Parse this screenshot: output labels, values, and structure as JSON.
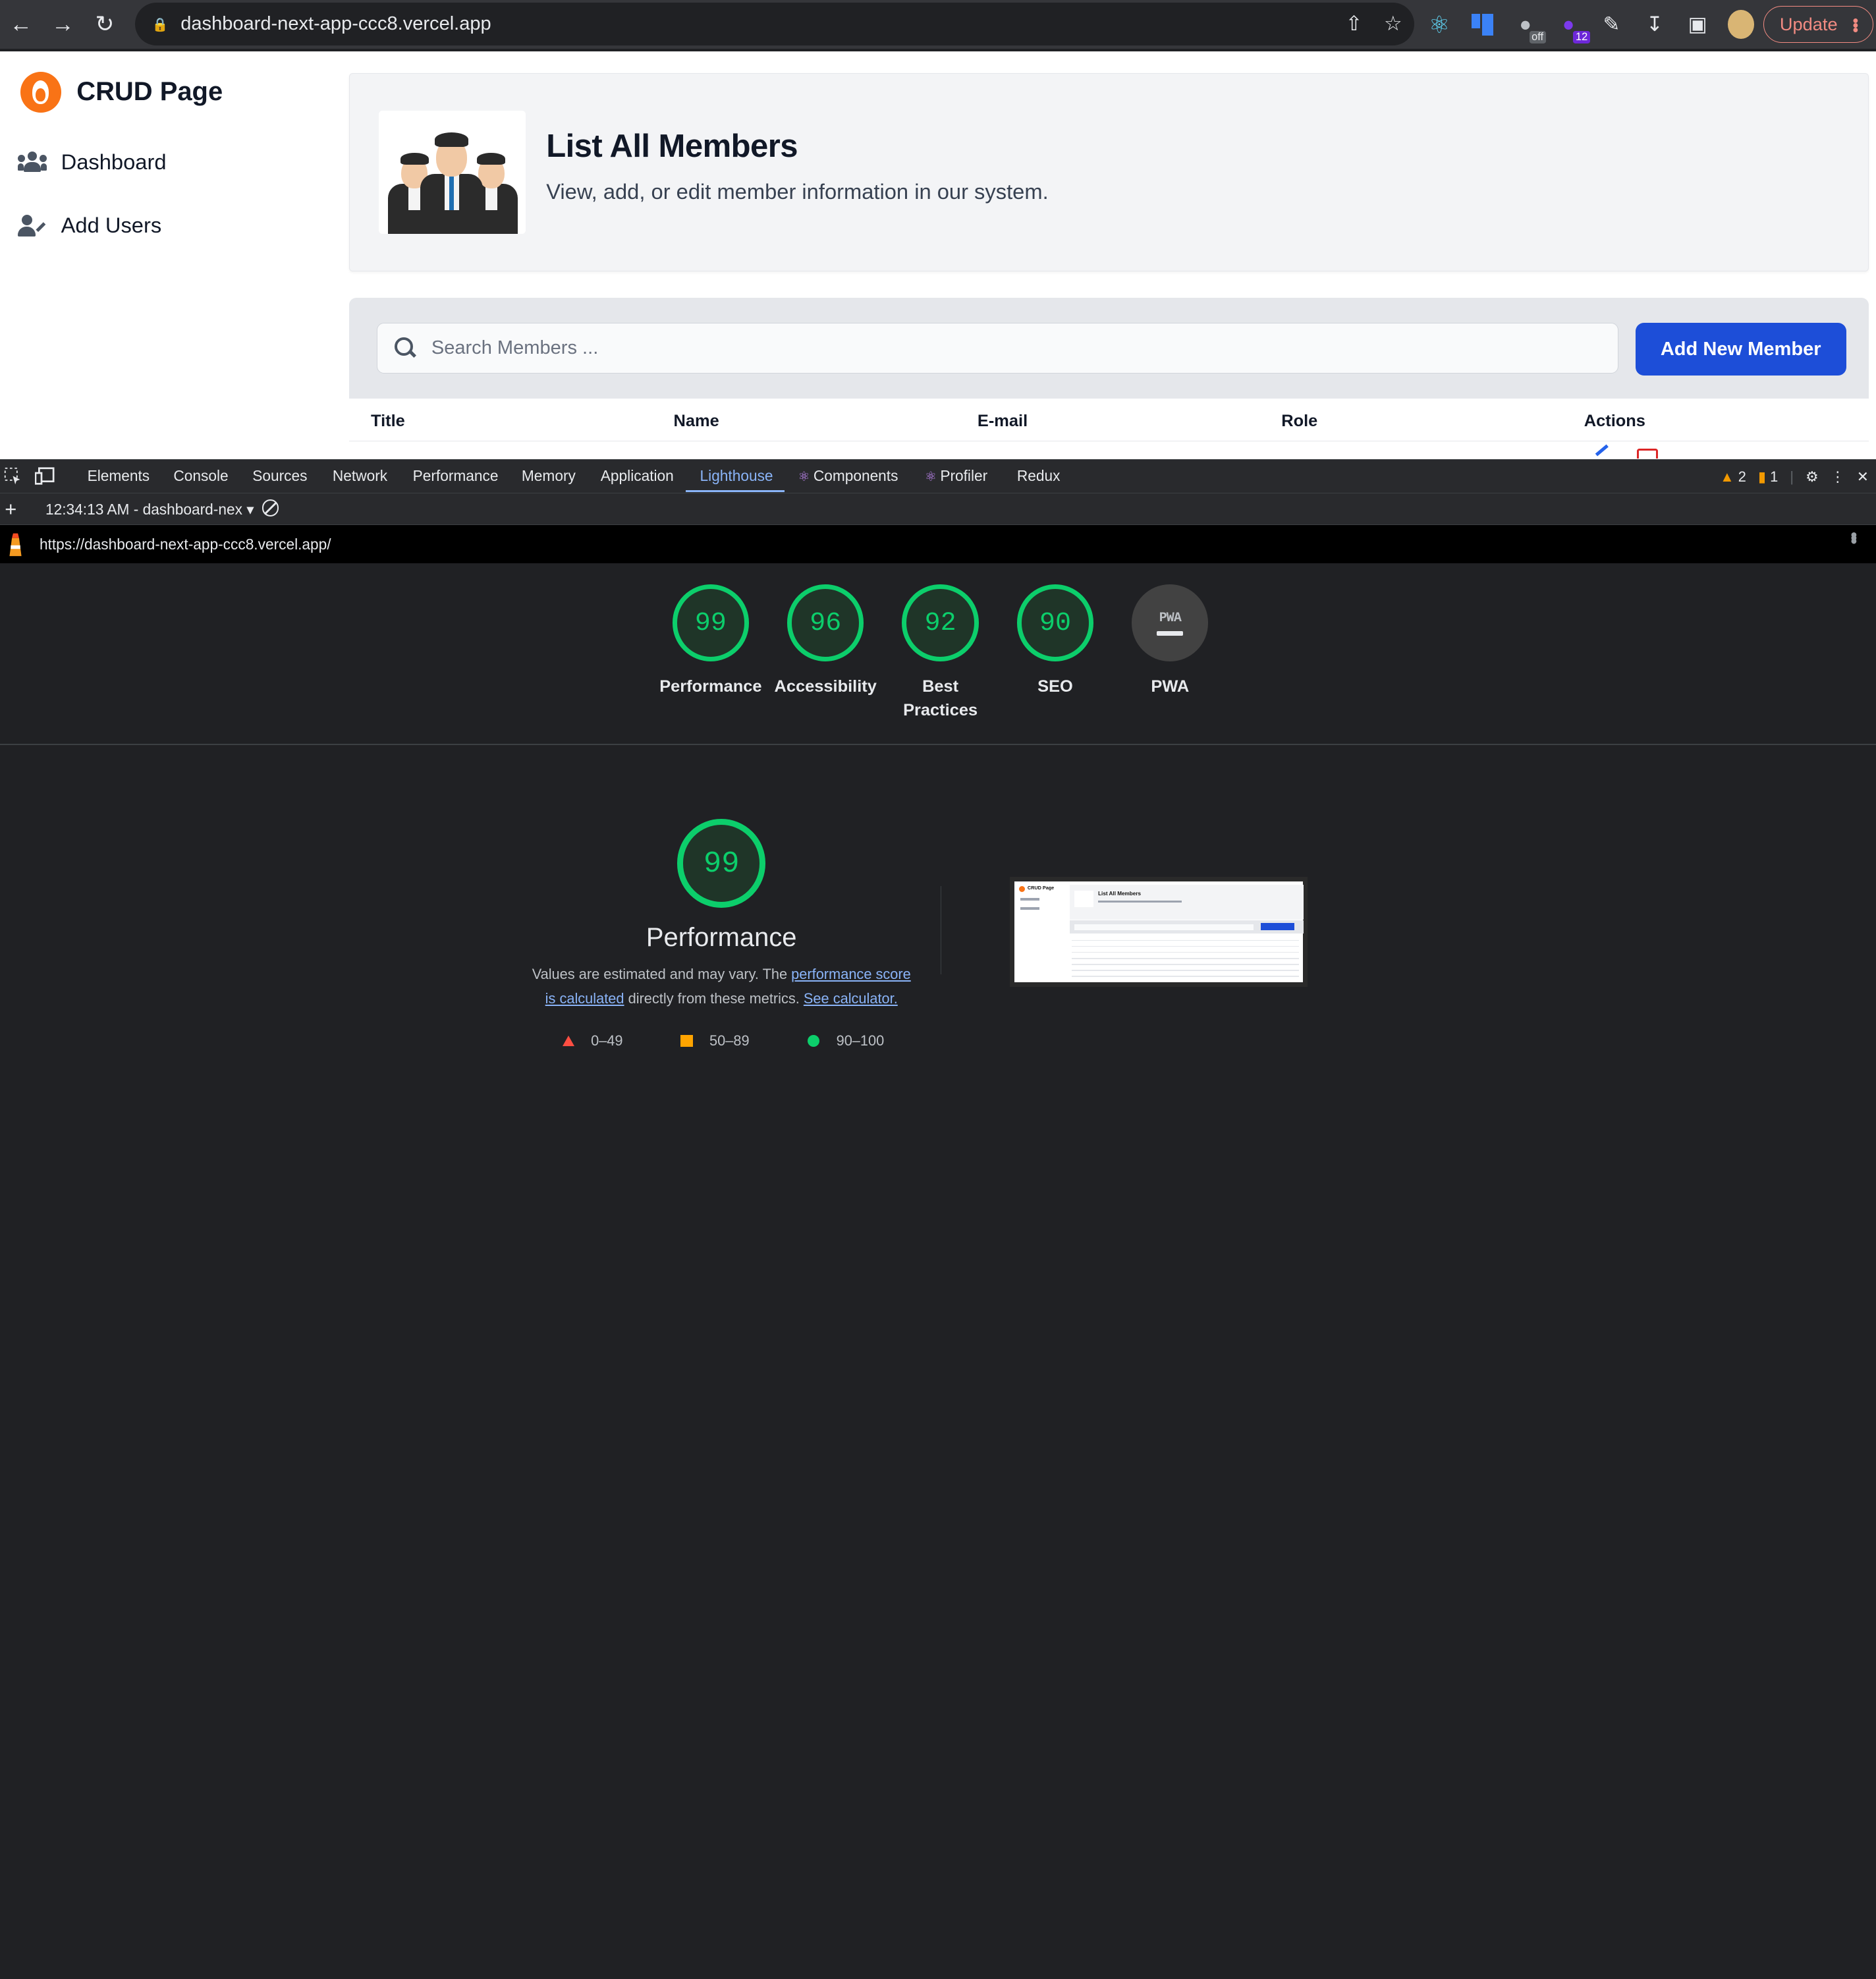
{
  "browser": {
    "url": "dashboard-next-app-ccc8.vercel.app",
    "update_label": "Update",
    "ext_off_badge": "off",
    "ext_count_badge": "12"
  },
  "sidebar": {
    "brand": "CRUD Page",
    "items": [
      {
        "label": "Dashboard",
        "icon": "users-icon"
      },
      {
        "label": "Add Users",
        "icon": "user-edit-icon"
      }
    ]
  },
  "header": {
    "title": "List All Members",
    "subtitle": "View, add, or edit member information in our system."
  },
  "search": {
    "placeholder": "Search Members ...",
    "value": ""
  },
  "add_button": "Add New Member",
  "table": {
    "columns": [
      "Title",
      "Name",
      "E-mail",
      "Role",
      "Actions"
    ]
  },
  "devtools": {
    "tabs": [
      "Elements",
      "Console",
      "Sources",
      "Network",
      "Performance",
      "Memory",
      "Application",
      "Lighthouse",
      "Components",
      "Profiler",
      "Redux"
    ],
    "active_tab": "Lighthouse",
    "warnings": "2",
    "messages": "1",
    "report_label": "12:34:13 AM - dashboard-nex",
    "report_url": "https://dashboard-next-app-ccc8.vercel.app/"
  },
  "lighthouse": {
    "scores": [
      {
        "value": "99",
        "label": "Performance"
      },
      {
        "value": "96",
        "label": "Accessibility"
      },
      {
        "value": "92",
        "label": "Best Practices"
      },
      {
        "value": "90",
        "label": "SEO"
      },
      {
        "value": "",
        "label": "PWA"
      }
    ],
    "pwa_badge": "PWA",
    "detail": {
      "score": "99",
      "title": "Performance",
      "desc_pre": "Values are estimated and may vary. The ",
      "desc_link1": "performance score is calculated",
      "desc_mid": " directly from these metrics. ",
      "desc_link2": "See calculator."
    },
    "legend": [
      {
        "range": "0–49",
        "color": "#ff4e42"
      },
      {
        "range": "50–89",
        "color": "#ffa400"
      },
      {
        "range": "90–100",
        "color": "#0cce6b"
      }
    ],
    "thumbnail": {
      "brand": "CRUD Page",
      "title": "List All Members"
    }
  },
  "colors": {
    "accent": "#1d4ed8",
    "pass": "#0cce6b",
    "average": "#ffa400",
    "fail": "#ff4e42"
  }
}
